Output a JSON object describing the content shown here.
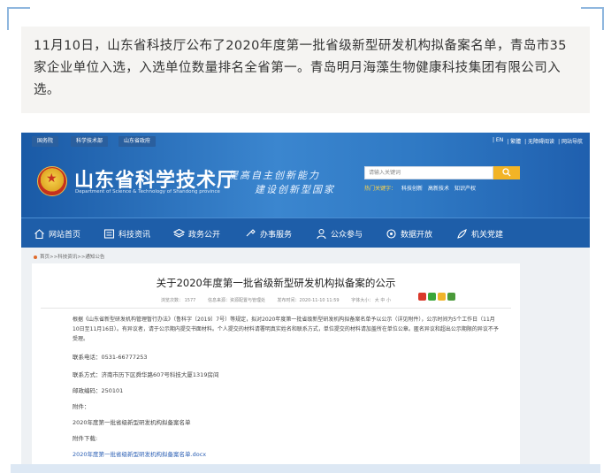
{
  "intro": {
    "text": "11月10日，山东省科技厅公布了2020年度第一批省级新型研发机构拟备案名单，青岛市35家企业单位入选，入选单位数量排名全省第一。青岛明月海藻生物健康科技集团有限公司入选。"
  },
  "site": {
    "top_tabs": [
      "国务院",
      "科学技术部",
      "山东省政府"
    ],
    "top_links": [
      "| EN",
      "| 繁體",
      "| 无障碍阅读",
      "| 网站导航"
    ],
    "title": "山东省科学技术厅",
    "subtitle": "Department of Science & Technology of Shandong province",
    "slogan_line1": "提高自主创新能力",
    "slogan_line2": "建设创新型国家",
    "search_placeholder": "请输入关键词",
    "hot_label": "热门关键字：",
    "hot_words": [
      "科技创新",
      "高新技术",
      "知识产权"
    ],
    "nav": [
      {
        "label": "网站首页",
        "icon": "home-icon"
      },
      {
        "label": "科技资讯",
        "icon": "news-icon"
      },
      {
        "label": "政务公开",
        "icon": "layers-icon"
      },
      {
        "label": "办事服务",
        "icon": "service-icon"
      },
      {
        "label": "公众参与",
        "icon": "people-icon"
      },
      {
        "label": "数据开放",
        "icon": "data-icon"
      },
      {
        "label": "机关党建",
        "icon": "party-icon"
      }
    ],
    "accent_color": "#1e5ea9",
    "search_button_color": "#f2b426"
  },
  "article": {
    "breadcrumb": "首页>>科技资讯>>通知公告",
    "title": "关于2020年度第一批省级新型研发机构拟备案的公示",
    "views": "浏览次数： 1577",
    "source": "信息来源：资源配置与管理处",
    "date": "发布时间：2020-11-10 11:59",
    "font_size": "字体大小： 大 中 小",
    "body": "根据《山东省新型研发机构管理暂行办法》（鲁科字〔2019〕7号）等规定，拟对2020年度第一批省级新型研发机构拟备案名单予以公示（详见附件），公示时间为5个工作日（11月10日至11月16日）。有异议者，请于公示期内提交书面材料。个人提交的材料请署明真实姓名和联系方式，单位提交的材料请加盖所在单位公章。匿名异议和超出公示期限的异议不予受理。",
    "phone": "联系电话：0531-66777253",
    "address": "联系方式：济南市历下区舜华路607号科技大厦1319房间",
    "postcode": "邮政编码：250101",
    "attachment_label": "附件：",
    "attachment_name": "2020年度第一批省级新型研发机构拟备案名单",
    "download_label": "附件下载:",
    "download_file": "2020年度第一批省级新型研发机构拟备案名单.docx"
  }
}
